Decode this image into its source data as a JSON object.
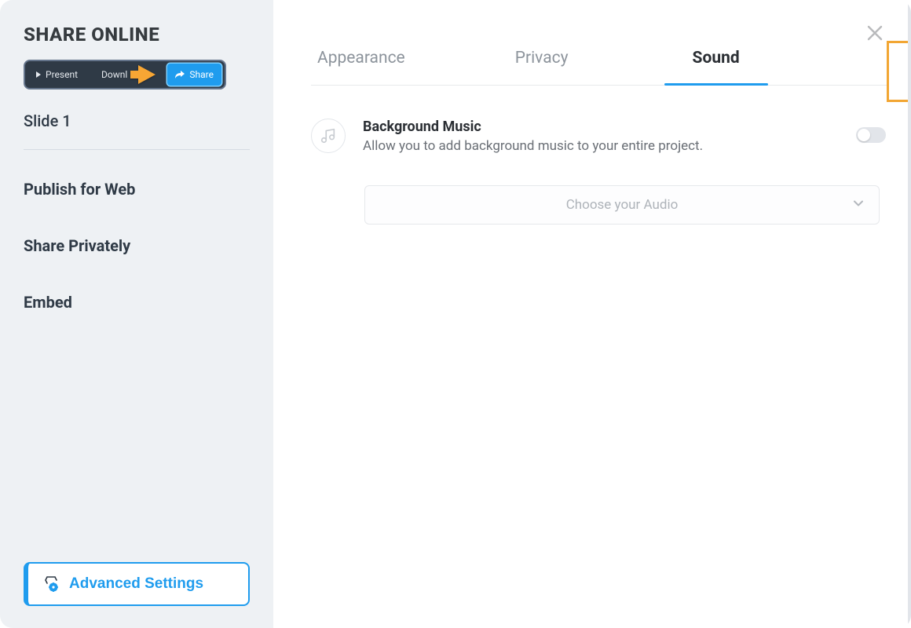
{
  "sidebar": {
    "title": "SHARE ONLINE",
    "toolbar": {
      "present": "Present",
      "download": "Downl",
      "share": "Share"
    },
    "slide_label": "Slide 1",
    "nav": {
      "publish": "Publish for Web",
      "private": "Share Privately",
      "embed": "Embed"
    },
    "advanced": "Advanced Settings"
  },
  "main": {
    "tabs": {
      "appearance": "Appearance",
      "privacy": "Privacy",
      "sound": "Sound"
    },
    "bg_music": {
      "title": "Background Music",
      "desc": "Allow you to add background music to your entire project."
    },
    "dropdown_placeholder": "Choose your Audio"
  }
}
